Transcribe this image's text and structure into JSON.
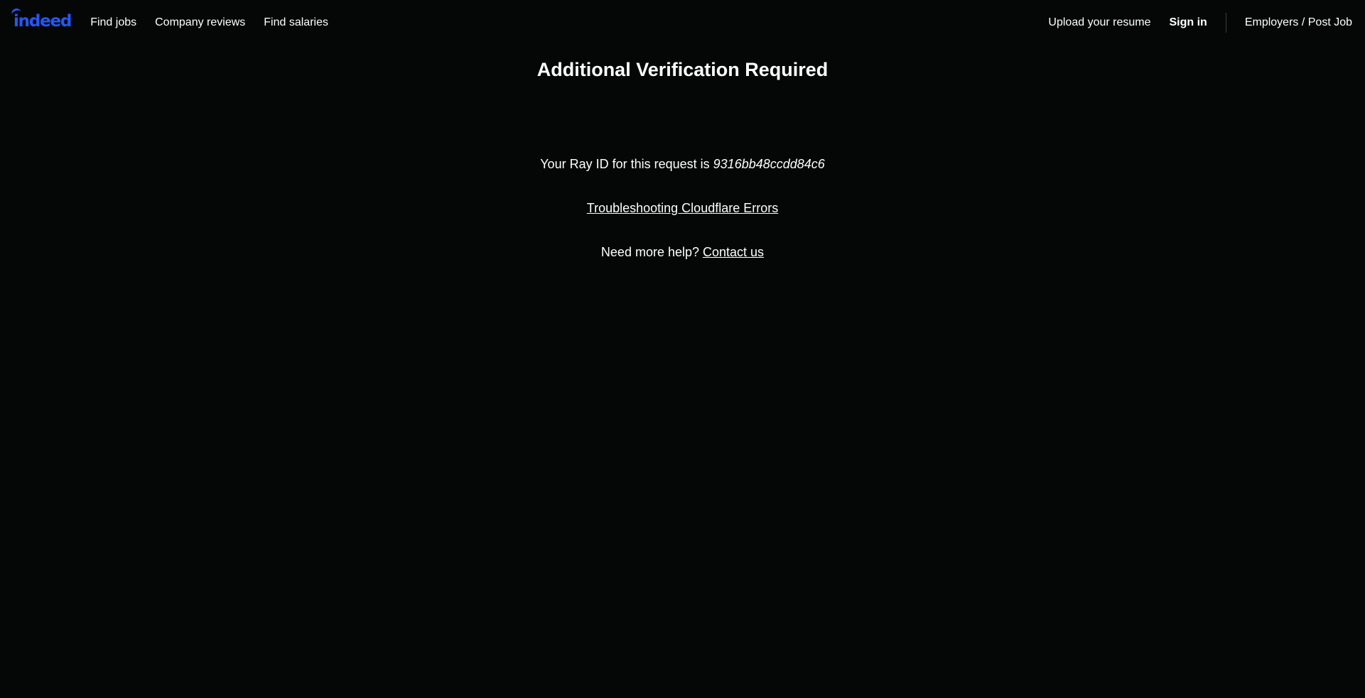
{
  "header": {
    "logo_text": "indeed",
    "brand_color": "#2557f5",
    "nav_left": {
      "find_jobs": "Find jobs",
      "company_reviews": "Company reviews",
      "find_salaries": "Find salaries"
    },
    "nav_right": {
      "upload_resume": "Upload your resume",
      "sign_in": "Sign in",
      "employers": "Employers / Post Job"
    }
  },
  "main": {
    "title": "Additional Verification Required",
    "ray_prefix": "Your Ray ID for this request is ",
    "ray_id": "9316bb48ccdd84c6",
    "troubleshooting_link": "Troubleshooting Cloudflare Errors",
    "help_prefix": "Need more help? ",
    "contact_link": "Contact us"
  },
  "colors": {
    "background": "#050707",
    "text": "#ffffff"
  }
}
